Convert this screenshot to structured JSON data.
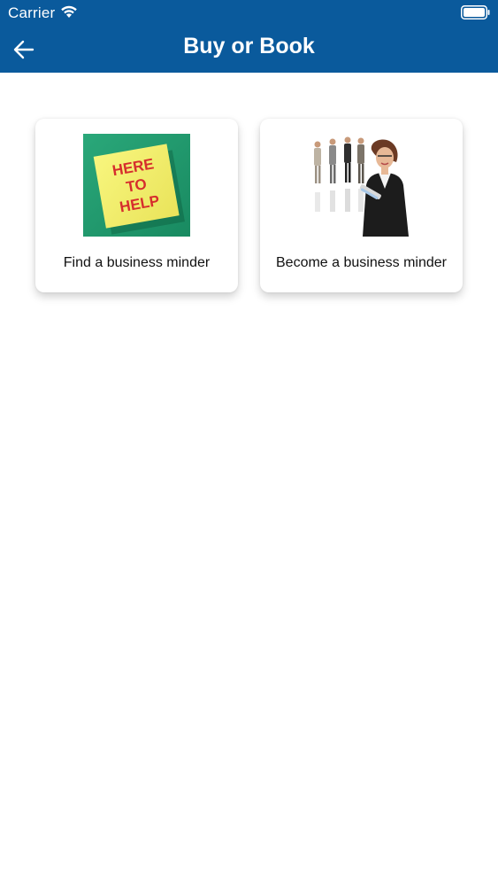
{
  "status": {
    "carrier": "Carrier"
  },
  "nav": {
    "title": "Buy or Book"
  },
  "cards": [
    {
      "label": "Find a business minder",
      "image_text": [
        "HERE",
        "TO",
        "HELP"
      ]
    },
    {
      "label": "Become a business minder"
    }
  ],
  "colors": {
    "header": "#0a5a9c",
    "note_yellow": "#f3f06a",
    "note_bg": "#1f9b6e",
    "note_text": "#d62d2d"
  },
  "icons": {
    "back": "arrow-left-icon",
    "wifi": "wifi-icon",
    "battery": "battery-icon"
  }
}
